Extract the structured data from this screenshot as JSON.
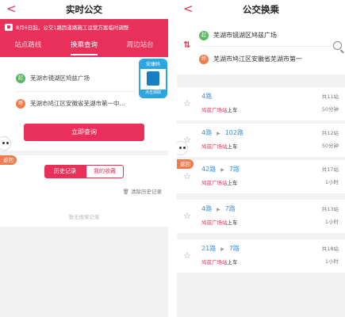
{
  "left": {
    "header": {
      "title": "实时公交",
      "back": "<"
    },
    "notice": "8月6日起，公交1路因道路施工运营方案临时调整",
    "tabs": [
      {
        "label": "站点路线",
        "active": false
      },
      {
        "label": "换乘查询",
        "active": true
      },
      {
        "label": "周边站台",
        "active": false
      }
    ],
    "query": {
      "from_badge": "起",
      "from": "芜湖市镜湖区鸠兹广场",
      "to_badge": "终",
      "to": "芜湖市鸠江区安徽省芜湖市第一中...",
      "button": "立即查询"
    },
    "ad": {
      "top": "安康码",
      "bottom": "点击领取"
    },
    "history": {
      "tab_active": "历史记录",
      "tab_inactive": "我的收藏",
      "clear": "清除历史记录",
      "empty": "暂无搜索记录"
    },
    "return_label": "返回"
  },
  "right": {
    "header": {
      "title": "公交换乘",
      "back": "<"
    },
    "from_badge": "起",
    "from": "芜湖市镜湖区鸠兹广场",
    "to_badge": "终",
    "to": "芜湖市鸠江区安徽省芜湖市第一",
    "results": [
      {
        "lines": [
          "4路"
        ],
        "board": "鸠兹广场站",
        "board_suffix": "上车",
        "stops": "共11站",
        "duration": "50分钟"
      },
      {
        "lines": [
          "4路",
          "102路"
        ],
        "board": "鸠兹广场站",
        "board_suffix": "上车",
        "stops": "共12站",
        "duration": "50分钟"
      },
      {
        "lines": [
          "42路",
          "7路"
        ],
        "board": "鸠兹广场站",
        "board_suffix": "上车",
        "stops": "共17站",
        "duration": "1小时"
      },
      {
        "lines": [
          "4路",
          "7路"
        ],
        "board": "鸠兹广场站",
        "board_suffix": "上车",
        "stops": "共13站",
        "duration": "1小时"
      },
      {
        "lines": [
          "21路",
          "7路"
        ],
        "board": "鸠兹广场站",
        "board_suffix": "上车",
        "stops": "共18站",
        "duration": "1小时"
      }
    ],
    "return_label": "返回"
  },
  "colors": {
    "accent": "#e8305a",
    "link": "#3a8ee6",
    "start": "#5ab865",
    "end": "#f07c4d"
  }
}
